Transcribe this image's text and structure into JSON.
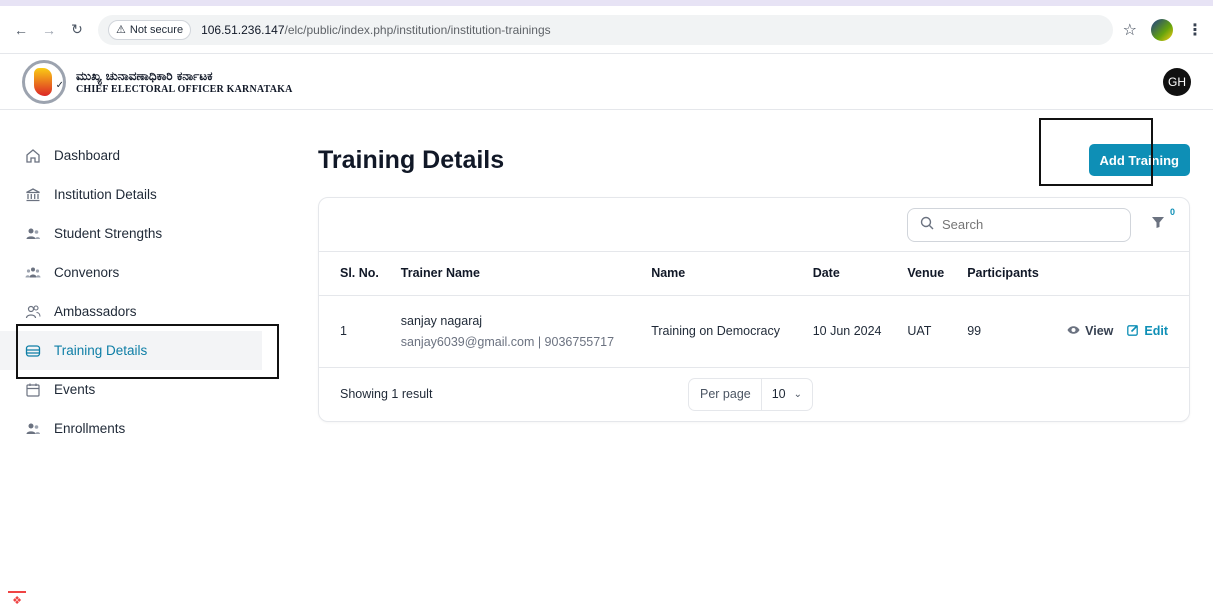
{
  "browser": {
    "security_label": "Not secure",
    "url_host": "106.51.236.147",
    "url_path": "/elc/public/index.php/institution/institution-trainings"
  },
  "header": {
    "brand_kannada": "ಮುಖ್ಯ ಚುನಾವಣಾಧಿಕಾರಿ ಕರ್ನಾಟಕ",
    "brand_english": "CHIEF ELECTORAL OFFICER KARNATAKA",
    "avatar_initials": "GH"
  },
  "sidebar": {
    "items": [
      {
        "label": "Dashboard",
        "icon": "home-icon"
      },
      {
        "label": "Institution Details",
        "icon": "institution-icon"
      },
      {
        "label": "Student Strengths",
        "icon": "users-icon"
      },
      {
        "label": "Convenors",
        "icon": "group-icon"
      },
      {
        "label": "Ambassadors",
        "icon": "user-group-icon"
      },
      {
        "label": "Training Details",
        "icon": "training-icon"
      },
      {
        "label": "Events",
        "icon": "calendar-icon"
      },
      {
        "label": "Enrollments",
        "icon": "enrollments-icon"
      }
    ],
    "active": "Training Details"
  },
  "main": {
    "title": "Training Details",
    "add_button": "Add Training",
    "search_placeholder": "Search",
    "filter_count": "0",
    "columns": [
      "Sl. No.",
      "Trainer Name",
      "Name",
      "Date",
      "Venue",
      "Participants"
    ],
    "rows": [
      {
        "sl": "1",
        "trainer_name": "sanjay nagaraj",
        "trainer_contact": "sanjay6039@gmail.com | 9036755717",
        "name": "Training on Democracy",
        "date": "10 Jun 2024",
        "venue": "UAT",
        "participants": "99",
        "view_label": "View",
        "edit_label": "Edit"
      }
    ],
    "showing": "Showing 1 result",
    "per_page_label": "Per page",
    "per_page_value": "10"
  },
  "colors": {
    "accent": "#0e8fb6",
    "active_text": "#0e7ea6"
  }
}
